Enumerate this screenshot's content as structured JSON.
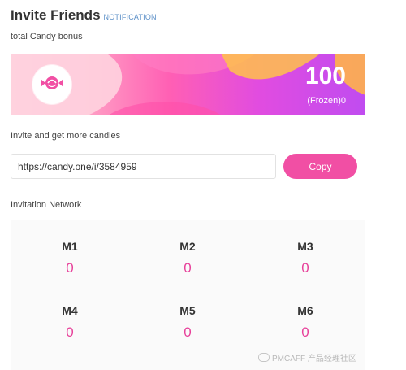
{
  "header": {
    "title": "Invite Friends",
    "notification": "NOTIFICATION"
  },
  "bonus": {
    "label": "total Candy bonus",
    "amount": "100",
    "frozen": "(Frozen)0"
  },
  "invite": {
    "label": "Invite and get more candies",
    "link": "https://candy.one/i/3584959",
    "copy_label": "Copy"
  },
  "network": {
    "label": "Invitation Network",
    "levels": [
      {
        "name": "M1",
        "value": "0"
      },
      {
        "name": "M2",
        "value": "0"
      },
      {
        "name": "M3",
        "value": "0"
      },
      {
        "name": "M4",
        "value": "0"
      },
      {
        "name": "M5",
        "value": "0"
      },
      {
        "name": "M6",
        "value": "0"
      }
    ]
  },
  "watermark": "PMCAFF 产品经理社区",
  "colors": {
    "accent": "#f14fa4",
    "value": "#e7409a",
    "notification": "#5b8fc7"
  }
}
